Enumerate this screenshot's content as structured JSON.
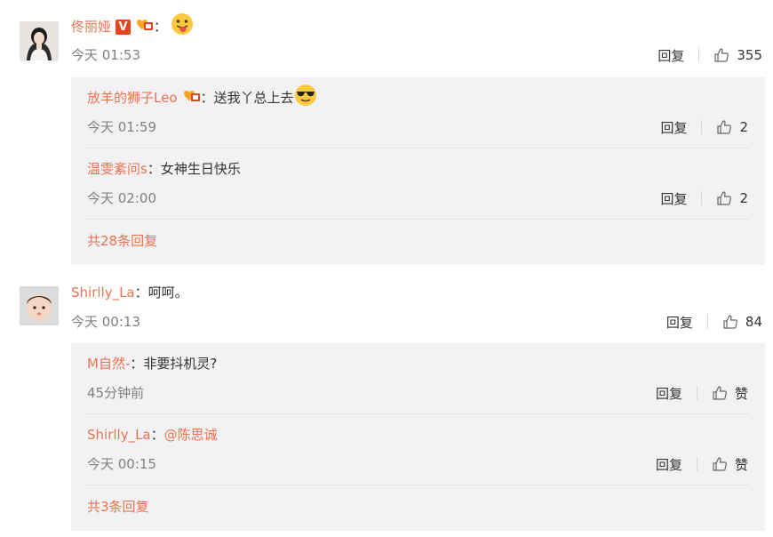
{
  "comments": [
    {
      "username": "佟丽娅",
      "colon": "：",
      "text": "",
      "time": "今天 01:53",
      "reply_label": "回复",
      "likes": "355",
      "badges": [
        "verified-v-badge",
        "fan-badge"
      ],
      "emoji": "tongue-out-emoji",
      "replies": [
        {
          "username": "放羊的狮子Leo",
          "colon": "：",
          "text": "送我丫总上去",
          "time": "今天 01:59",
          "reply_label": "回复",
          "likes": "2",
          "badges": [
            "fan-badge"
          ],
          "emoji": "sunglasses-emoji"
        },
        {
          "username": "温雯紊问s",
          "colon": "：",
          "text": "女神生日快乐",
          "time": "今天 02:00",
          "reply_label": "回复",
          "likes": "2"
        }
      ],
      "more_replies": "共28条回复"
    },
    {
      "username": "Shirlly_La",
      "colon": "：",
      "text": "呵呵。",
      "time": "今天 00:13",
      "reply_label": "回复",
      "likes": "84",
      "replies": [
        {
          "username": "M自然-",
          "colon": "：",
          "text": "非要抖机灵?",
          "time": "45分钟前",
          "reply_label": "回复",
          "likes": "赞"
        },
        {
          "username": "Shirlly_La",
          "colon": "：",
          "mention": "@陈思诚",
          "time": "今天 00:15",
          "reply_label": "回复",
          "likes": "赞"
        }
      ],
      "more_replies": "共3条回复"
    }
  ],
  "colors": {
    "username": "#eb7350",
    "reply_bg": "#f2f2f5",
    "muted": "#808080"
  }
}
